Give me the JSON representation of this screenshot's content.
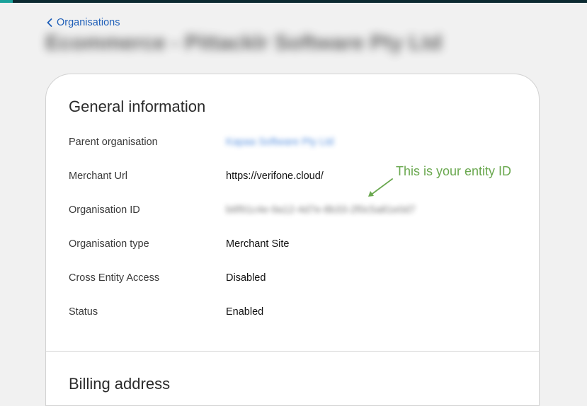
{
  "nav": {
    "back_label": "Organisations"
  },
  "page": {
    "title": "Ecommerce - Pittacklr Software Pty Ltd"
  },
  "general": {
    "title": "General information",
    "rows": [
      {
        "label": "Parent organisation",
        "value": "Kapaa Software Pty Ltd"
      },
      {
        "label": "Merchant Url",
        "value": "https://verifone.cloud/"
      },
      {
        "label": "Organisation ID",
        "value": "b6f91c4e-9a12-4d7e-8b33-2f0c5a81e0d7"
      },
      {
        "label": "Organisation type",
        "value": "Merchant Site"
      },
      {
        "label": "Cross Entity Access",
        "value": "Disabled"
      },
      {
        "label": "Status",
        "value": "Enabled"
      }
    ]
  },
  "billing": {
    "title": "Billing address"
  },
  "annotation": {
    "text": "This is your entity ID",
    "color": "#6aa84f"
  },
  "colors": {
    "topbar": "#0c2a31",
    "accent": "#1aa19a",
    "link": "#1f5fb8"
  },
  "icons": {
    "back": "chevron-left-icon",
    "annotation": "arrow-icon"
  }
}
